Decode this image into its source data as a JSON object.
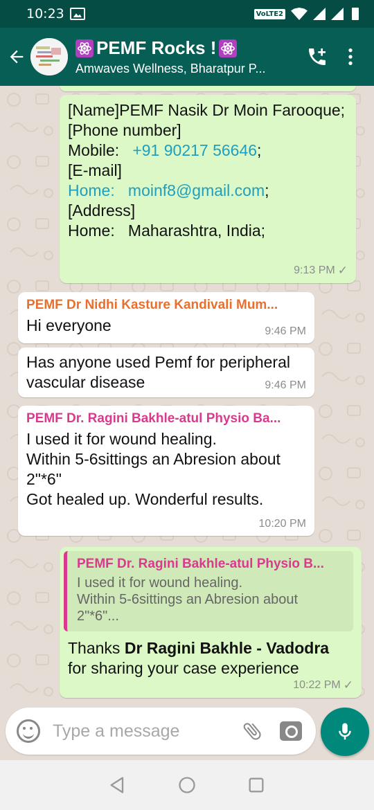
{
  "status_bar": {
    "time": "10:23",
    "network": "VoLTE2"
  },
  "header": {
    "title": "PEMF Rocks !",
    "subtitle": "Amwaves Wellness, Bharatpur P..."
  },
  "messages": {
    "m1": {
      "lines": [
        "[Name]PEMF Nasik Dr Moin Farooque;",
        "[Phone number]"
      ],
      "mobile_label": "Mobile:",
      "mobile_value": "+91 90217 56646",
      "email_header": "[E-mail]",
      "home_label": "Home:",
      "email_value": "moinf8@gmail.com",
      "address_header": "[Address]",
      "address_line": "Home:   Maharashtra, India;",
      "time": "9:13 PM"
    },
    "m2": {
      "sender": "PEMF Dr Nidhi Kasture Kandivali Mum...",
      "text": "Hi everyone",
      "time": "9:46 PM"
    },
    "m3": {
      "text": "Has anyone used Pemf for peripheral vascular disease",
      "time": "9:46 PM"
    },
    "m4": {
      "sender": "PEMF Dr. Ragini Bakhle-atul Physio Ba...",
      "text_l1": "I used it for wound healing.",
      "text_l2": "Within 5-6sittings an Abresion about 2\"*6\"",
      "text_l3": "Got healed up. Wonderful results.",
      "time": "10:20 PM"
    },
    "m5": {
      "quote_sender": "PEMF Dr. Ragini Bakhle-atul Physio B...",
      "quote_l1": "I used it for wound healing.",
      "quote_l2": "Within 5-6sittings an Abresion about",
      "quote_l3": "2\"*6\"...",
      "text_pre": "Thanks ",
      "text_bold": "Dr Ragini Bakhle - Vadodra",
      "text_post": "for sharing your case experience",
      "time": "10:22 PM"
    }
  },
  "input": {
    "placeholder": "Type a message"
  },
  "colors": {
    "header": "#075e54",
    "status": "#054d44",
    "outgoing": "#dcf8c6",
    "accent": "#00897b"
  }
}
